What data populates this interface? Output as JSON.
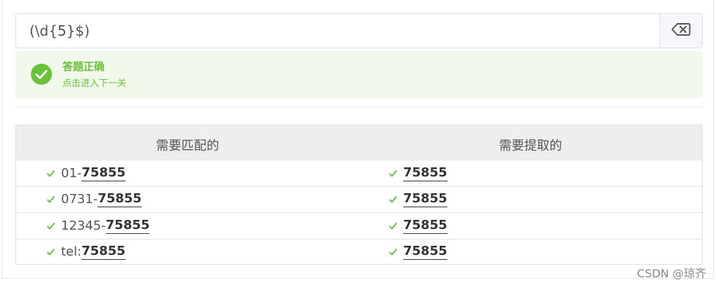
{
  "input": {
    "value": "(\\d{5}$)",
    "clear_icon": "backspace-icon"
  },
  "alert": {
    "title": "答题正确",
    "description": "点击进入下一关",
    "icon": "check-circle-icon",
    "color": "#67c23a"
  },
  "table": {
    "headers": {
      "match": "需要匹配的",
      "extract": "需要提取的"
    },
    "rows": [
      {
        "prefix": "01-",
        "match": "75855",
        "extract": "75855"
      },
      {
        "prefix": "0731-",
        "match": "75855",
        "extract": "75855"
      },
      {
        "prefix": "12345-",
        "match": "75855",
        "extract": "75855"
      },
      {
        "prefix": "tel:",
        "match": "75855",
        "extract": "75855"
      }
    ]
  },
  "watermark": "CSDN @琼齐"
}
